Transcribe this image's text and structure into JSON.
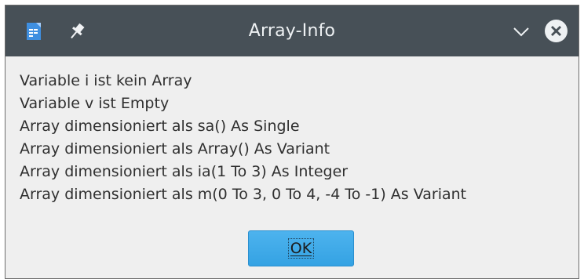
{
  "window": {
    "title": "Array-Info",
    "icons": {
      "app": "document-basic-icon",
      "pin": "pin-icon",
      "minimize": "chevron-down-icon",
      "close": "close-icon"
    }
  },
  "message": {
    "lines": [
      "Variable i ist kein Array",
      "Variable v ist Empty",
      "Array dimensioniert als sa() As Single",
      "Array dimensioniert als Array() As Variant",
      "Array dimensioniert als ia(1 To 3) As Integer",
      "Array dimensioniert als m(0 To 3, 0 To 4, -4 To -1) As Variant"
    ]
  },
  "buttons": {
    "ok": "OK"
  },
  "colors": {
    "titlebar": "#475057",
    "dialog_bg": "#efefef",
    "accent": "#3daaea"
  }
}
